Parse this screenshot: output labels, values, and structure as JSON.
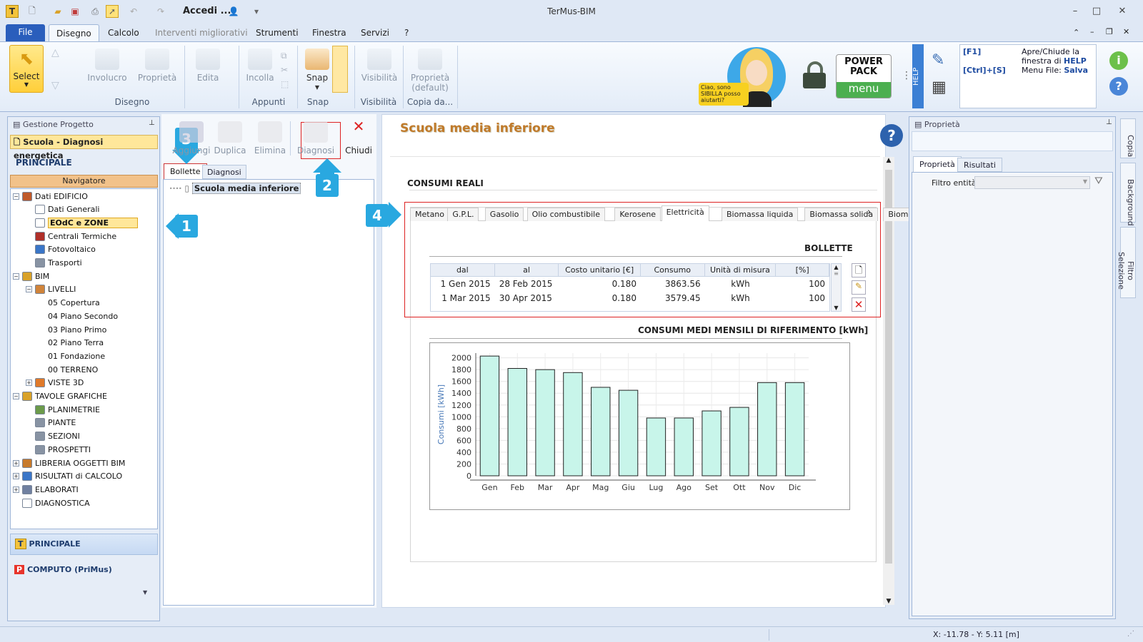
{
  "window": {
    "title": "TerMus-BIM",
    "login": "Accedi ..."
  },
  "menu": {
    "file": "File",
    "tabs": [
      "Disegno",
      "Calcolo",
      "Interventi migliorativi",
      "Strumenti",
      "Finestra",
      "Servizi",
      "?"
    ]
  },
  "ribbon": {
    "select": "Select",
    "involucro": "Involucro",
    "proprieta": "Proprietà",
    "edita": "Edita",
    "incolla": "Incolla",
    "snap": "Snap",
    "visibilita": "Visibilità",
    "proprieta_default": "Proprietà (default)",
    "groups": {
      "disegno": "Disegno",
      "appunti": "Appunti",
      "snap": "Snap",
      "visibilita": "Visibilità",
      "copia": "Copia da..."
    },
    "sibilla": "Ciao, sono SIBILLA posso aiutarti?",
    "powerpack_top": "POWER PACK",
    "powerpack_menu": "menu",
    "help_side": "HELP",
    "help": {
      "k1": "[F1]",
      "t1a": "Apre/Chiude la",
      "t1b": "finestra di",
      "t1c": "HELP",
      "k2": "[Ctrl]+[S]",
      "t2a": "Menu File:",
      "t2b": "Salva"
    }
  },
  "left": {
    "header": "Gestione Progetto",
    "project": "Scuola - Diagnosi energetica",
    "section": "PRINCIPALE",
    "navigator": "Navigatore",
    "tree": [
      "Dati EDIFICIO",
      "Dati Generali",
      "EOdC e ZONE",
      "Centrali Termiche",
      "Fotovoltaico",
      "Trasporti",
      "BIM",
      "LIVELLI",
      "05 Copertura",
      "04 Piano Secondo",
      "03 Piano Primo",
      "02 Piano Terra",
      "01 Fondazione",
      "00 TERRENO",
      "VISTE 3D",
      "TAVOLE GRAFICHE",
      "PLANIMETRIE",
      "PIANTE",
      "SEZIONI",
      "PROSPETTI",
      "LIBRERIA OGGETTI BIM",
      "RISULTATI di CALCOLO",
      "ELABORATI",
      "DIAGNOSTICA"
    ],
    "bottom": [
      "PRINCIPALE",
      "COMPUTO (PriMus)"
    ]
  },
  "middle": {
    "tools": [
      "Aggiungi",
      "Duplica",
      "Elimina",
      "Diagnosi",
      "Chiudi"
    ],
    "tabs": [
      "Bollette",
      "Diagnosi"
    ],
    "item": "Scuola media inferiore"
  },
  "main": {
    "title": "Scuola media inferiore",
    "section": "CONSUMI REALI",
    "fuel_tabs": [
      "Metano",
      "G.P.L.",
      "Gasolio",
      "Olio combustibile",
      "Kerosene",
      "Elettricità",
      "Biomassa liquida",
      "Biomassa solida",
      "Biomassa gassosa"
    ],
    "bollette_title": "BOLLETTE",
    "columns": [
      "dal",
      "al",
      "Costo unitario [€]",
      "Consumo",
      "Unità di misura",
      "[%]"
    ],
    "rows": [
      [
        "1 Gen 2015",
        "28 Feb 2015",
        "0.180",
        "3863.56",
        "kWh",
        "100"
      ],
      [
        "1 Mar 2015",
        "30 Apr 2015",
        "0.180",
        "3579.45",
        "kWh",
        "100"
      ]
    ]
  },
  "chart_data": {
    "type": "bar",
    "title": "CONSUMI MEDI MENSILI DI RIFERIMENTO [kWh]",
    "ylabel": "Consumi [kWh]",
    "categories": [
      "Gen",
      "Feb",
      "Mar",
      "Apr",
      "Mag",
      "Giu",
      "Lug",
      "Ago",
      "Set",
      "Ott",
      "Nov",
      "Dic"
    ],
    "values": [
      2030,
      1820,
      1800,
      1750,
      1500,
      1450,
      980,
      980,
      1100,
      1160,
      1580,
      1580
    ],
    "ylim": [
      0,
      2000
    ],
    "yticks": [
      0,
      200,
      400,
      600,
      800,
      1000,
      1200,
      1400,
      1600,
      1800,
      2000
    ],
    "grid": true,
    "bar_color": "#c8f5ea"
  },
  "right": {
    "header": "Proprietà",
    "tabs": [
      "Proprietà",
      "Risultati"
    ],
    "filter": "Filtro entità",
    "vtabs": [
      "Copia",
      "Background",
      "Filtro Selezione"
    ]
  },
  "callouts": [
    "1",
    "2",
    "3",
    "4"
  ],
  "status": {
    "coords": "X: -11.78 - Y: 5.11 [m]"
  }
}
